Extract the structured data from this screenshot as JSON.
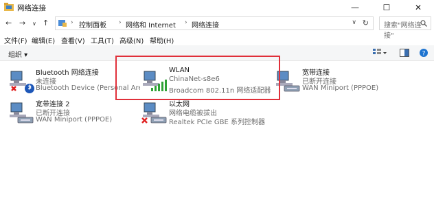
{
  "window": {
    "title": "网络连接",
    "minimize_icon": "minimize-icon",
    "maximize_icon": "maximize-icon",
    "close_icon": "close-icon"
  },
  "address": {
    "crumbs": [
      "控制面板",
      "网络和 Internet",
      "网络连接"
    ],
    "search_placeholder": "搜索\"网络连接\""
  },
  "menu": [
    "文件(F)",
    "编辑(E)",
    "查看(V)",
    "工具(T)",
    "高级(N)",
    "帮助(H)"
  ],
  "toolbar": {
    "organize": "组织 ▾"
  },
  "connections": [
    {
      "name": "Bluetooth 网络连接",
      "status": "未连接",
      "device": "Bluetooth Device (Personal Area...",
      "icon": "bluetooth-network-icon",
      "state": "disconnected"
    },
    {
      "name": "WLAN",
      "status": "ChinaNet-s8e6",
      "device": "Broadcom 802.11n 网络适配器",
      "icon": "wifi-network-icon",
      "state": "connected"
    },
    {
      "name": "宽带连接",
      "status": "已断开连接",
      "device": "WAN Miniport (PPPOE)",
      "icon": "broadband-network-icon",
      "state": "idle"
    },
    {
      "name": "宽带连接 2",
      "status": "已断开连接",
      "device": "WAN Miniport (PPPOE)",
      "icon": "broadband-network-icon",
      "state": "idle"
    },
    {
      "name": "以太网",
      "status": "网络电缆被拔出",
      "device": "Realtek PCIe GBE 系列控制器",
      "icon": "ethernet-network-icon",
      "state": "disconnected"
    }
  ]
}
